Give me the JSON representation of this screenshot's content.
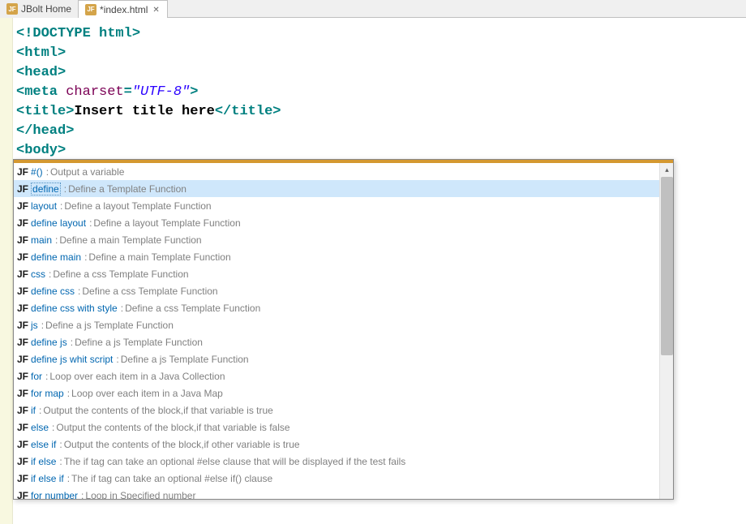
{
  "tabs": [
    {
      "icon": "JF",
      "label": "JBolt Home",
      "active": false,
      "closable": false
    },
    {
      "icon": "JF",
      "label": "*index.html",
      "active": true,
      "closable": true
    }
  ],
  "code": {
    "line1_doctype": "<!DOCTYPE html>",
    "line2": "<html>",
    "line3": "<head>",
    "line4_open": "<meta ",
    "line4_attr": "charset",
    "line4_eq": "=",
    "line4_val": "\"UTF-8\"",
    "line4_close": ">",
    "line5_open": "<title>",
    "line5_text": "Insert title here",
    "line5_close": "</title>",
    "line6": "</head>",
    "line7": "<body>",
    "line8": "#"
  },
  "autocomplete": {
    "prefix": "JF",
    "selected_index": 1,
    "items": [
      {
        "key": "#()",
        "desc": "Output a variable"
      },
      {
        "key": "define",
        "desc": "Define a Template Function"
      },
      {
        "key": "layout",
        "desc": "Define a layout Template Function"
      },
      {
        "key": "define layout",
        "desc": "Define a layout Template Function"
      },
      {
        "key": "main",
        "desc": "Define a main Template Function"
      },
      {
        "key": "define main",
        "desc": "Define a main Template Function"
      },
      {
        "key": "css",
        "desc": "Define a css Template Function"
      },
      {
        "key": "define css",
        "desc": "Define a css Template Function"
      },
      {
        "key": "define css with style",
        "desc": "Define a css Template Function"
      },
      {
        "key": "js",
        "desc": "Define a js Template Function"
      },
      {
        "key": "define js",
        "desc": "Define a js Template Function"
      },
      {
        "key": "define js whit script",
        "desc": "Define a js Template Function"
      },
      {
        "key": "for",
        "desc": "Loop over each item in a Java Collection"
      },
      {
        "key": "for map",
        "desc": "Loop over each item in a Java Map"
      },
      {
        "key": "if",
        "desc": "Output the contents of the block,if that variable is true"
      },
      {
        "key": "else",
        "desc": "Output the contents of the block,if that variable is false"
      },
      {
        "key": "else if",
        "desc": "Output the contents of the block,if other variable is true"
      },
      {
        "key": "if else",
        "desc": "The if tag can take an optional #else clause that will be displayed if the test fails"
      },
      {
        "key": "if else if",
        "desc": "The if tag can take an optional #else if() clause"
      },
      {
        "key": "for number",
        "desc": "Loop in Specified number"
      }
    ],
    "separator": " : "
  }
}
